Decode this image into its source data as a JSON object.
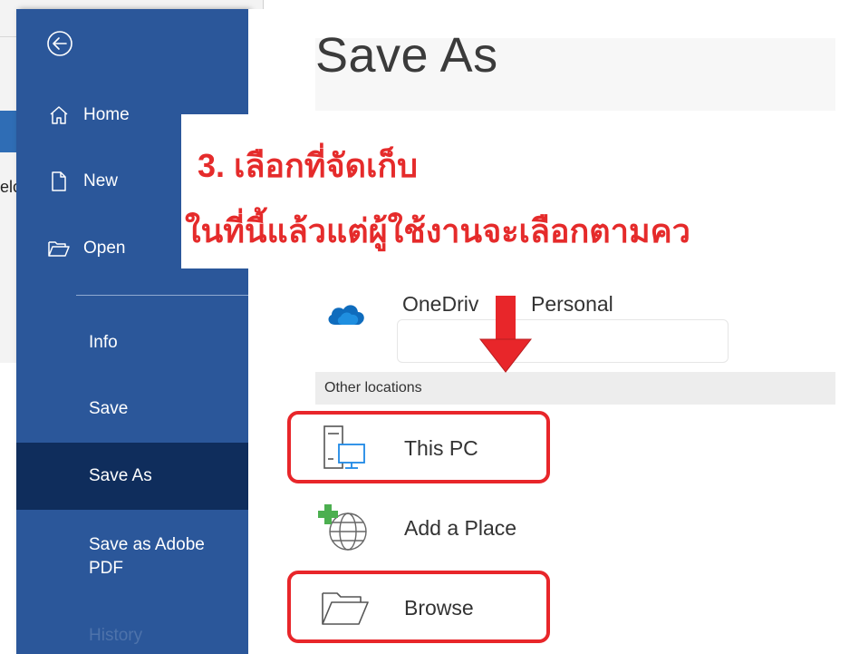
{
  "window": {
    "title": "Save As"
  },
  "background": {
    "fragment_text": "elc"
  },
  "sidebar": {
    "back_label": "Back",
    "items": [
      {
        "label": "Home",
        "icon": "home-icon"
      },
      {
        "label": "New",
        "icon": "new-document-icon"
      },
      {
        "label": "Open",
        "icon": "open-folder-icon"
      },
      {
        "label": "Info"
      },
      {
        "label": "Save"
      },
      {
        "label": "Save As",
        "active": true
      },
      {
        "label": "Save as Adobe PDF"
      },
      {
        "label": "History",
        "disabled": true
      }
    ]
  },
  "main": {
    "title": "Save As",
    "annotation": {
      "line1": "3. เลือกที่จัดเก็บ",
      "line2": "ในที่นี้แล้วแต่ผู้ใช้งานจะเลือกตามคว"
    },
    "onedrive": {
      "label_left": "OneDriv",
      "label_right": "Personal",
      "icon": "onedrive-cloud-icon"
    },
    "other_locations_label": "Other locations",
    "locations": [
      {
        "label": "This PC",
        "icon": "this-pc-icon"
      },
      {
        "label": "Add a Place",
        "icon": "add-place-globe-icon"
      },
      {
        "label": "Browse",
        "icon": "browse-folder-icon"
      }
    ]
  },
  "colors": {
    "sidebar_bg": "#2b579a",
    "sidebar_active_bg": "#0f2d5c",
    "annotation_red": "#e52b2b",
    "highlight_red": "#e8262a"
  }
}
